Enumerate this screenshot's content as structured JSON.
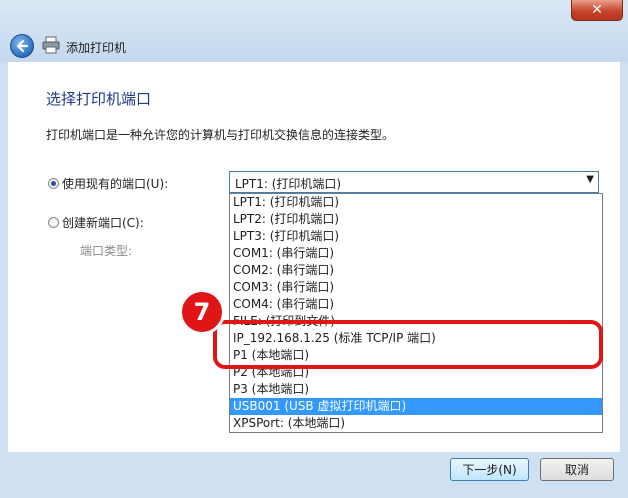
{
  "window": {
    "title": "添加打印机",
    "close_glyph": "✕",
    "back_icon": "back-arrow-icon",
    "printer_icon": "printer-icon"
  },
  "page": {
    "heading": "选择打印机端口",
    "description": "打印机端口是一种允许您的计算机与打印机交换信息的连接类型。"
  },
  "options": {
    "existing_label": "使用现有的端口(U):",
    "create_label": "创建新端口(C):",
    "port_type_label": "端口类型:",
    "selected_value": "LPT1: (打印机端口)"
  },
  "dropdown": {
    "items": [
      "LPT1: (打印机端口)",
      "LPT2: (打印机端口)",
      "LPT3: (打印机端口)",
      "COM1: (串行端口)",
      "COM2: (串行端口)",
      "COM3: (串行端口)",
      "COM4: (串行端口)",
      "FILE: (打印到文件)",
      "IP_192.168.1.25 (标准 TCP/IP 端口)",
      "P1 (本地端口)",
      "P2 (本地端口)",
      "P3 (本地端口)",
      "USB001 (USB 虚拟打印机端口)",
      "XPSPort: (本地端口)"
    ],
    "highlighted_index": 12
  },
  "annotation": {
    "step": "7",
    "color": "#e01515"
  },
  "buttons": {
    "next": "下一步(N)",
    "cancel": "取消"
  },
  "colors": {
    "selection": "#3399ff",
    "heading": "#1e3a8a"
  }
}
